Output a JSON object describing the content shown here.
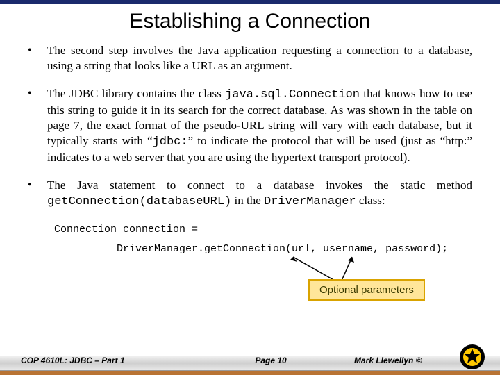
{
  "title": "Establishing a Connection",
  "bullets": [
    {
      "text_html": "The second step involves the Java application requesting a connection to a database, using a string that looks like a URL as an argument."
    },
    {
      "text_html": "The JDBC library contains the class <span class='code'>java.sql.Connection</span> that knows how to use this string to guide it in its search for the correct database.  As was shown in the table on page 7, the exact format of the pseudo-URL string will vary with each database, but it typically starts with “<span class='code'>jdbc:</span>” to indicate the protocol that will be used (just as “http:” indicates to a web server that you are using the hypertext transport protocol)."
    },
    {
      "text_html": "The Java statement to connect to a database invokes the static method <span class='code'>getConnection(databaseURL)</span> in the <span class='code'>DriverManager</span> class:"
    }
  ],
  "code": {
    "line1": "Connection connection =",
    "line2": "DriverManager.getConnection(url, username, password);"
  },
  "callout": "Optional parameters",
  "footer": {
    "left": "COP 4610L: JDBC – Part 1",
    "center": "Page 10",
    "right": "Mark Llewellyn ©"
  }
}
